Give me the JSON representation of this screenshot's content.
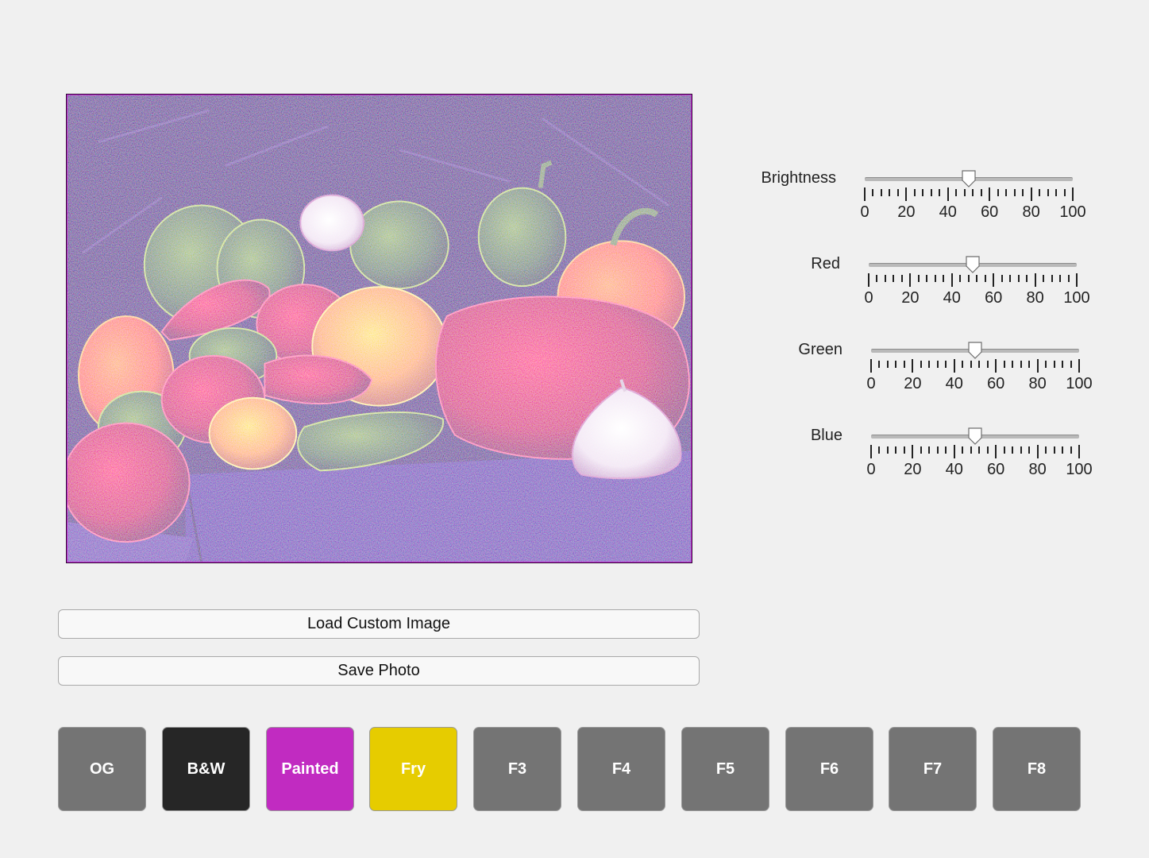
{
  "sliders": [
    {
      "label": "Brightness",
      "value": 50,
      "min": 0,
      "max": 100,
      "ticks": [
        "0",
        "20",
        "40",
        "60",
        "80",
        "100"
      ]
    },
    {
      "label": "Red",
      "value": 50,
      "min": 0,
      "max": 100,
      "ticks": [
        "0",
        "20",
        "40",
        "60",
        "80",
        "100"
      ]
    },
    {
      "label": "Green",
      "value": 50,
      "min": 0,
      "max": 100,
      "ticks": [
        "0",
        "20",
        "40",
        "60",
        "80",
        "100"
      ]
    },
    {
      "label": "Blue",
      "value": 50,
      "min": 0,
      "max": 100,
      "ticks": [
        "0",
        "20",
        "40",
        "60",
        "80",
        "100"
      ]
    }
  ],
  "actions": {
    "load_label": "Load Custom Image",
    "save_label": "Save Photo"
  },
  "filters": [
    {
      "label": "OG",
      "color": "#747474",
      "text_color": "#ffffff"
    },
    {
      "label": "B&W",
      "color": "#262626",
      "text_color": "#ffffff"
    },
    {
      "label": "Painted",
      "color": "#c12bc1",
      "text_color": "#ffffff"
    },
    {
      "label": "Fry",
      "color": "#e6cc00",
      "text_color": "#ffffff"
    },
    {
      "label": "F3",
      "color": "#747474",
      "text_color": "#ffffff"
    },
    {
      "label": "F4",
      "color": "#747474",
      "text_color": "#ffffff"
    },
    {
      "label": "F5",
      "color": "#747474",
      "text_color": "#ffffff"
    },
    {
      "label": "F6",
      "color": "#747474",
      "text_color": "#ffffff"
    },
    {
      "label": "F7",
      "color": "#747474",
      "text_color": "#ffffff"
    },
    {
      "label": "F8",
      "color": "#747474",
      "text_color": "#ffffff"
    }
  ],
  "image": {
    "subject": "peppers-and-garlic-still-life",
    "filter_applied": "Fry"
  }
}
